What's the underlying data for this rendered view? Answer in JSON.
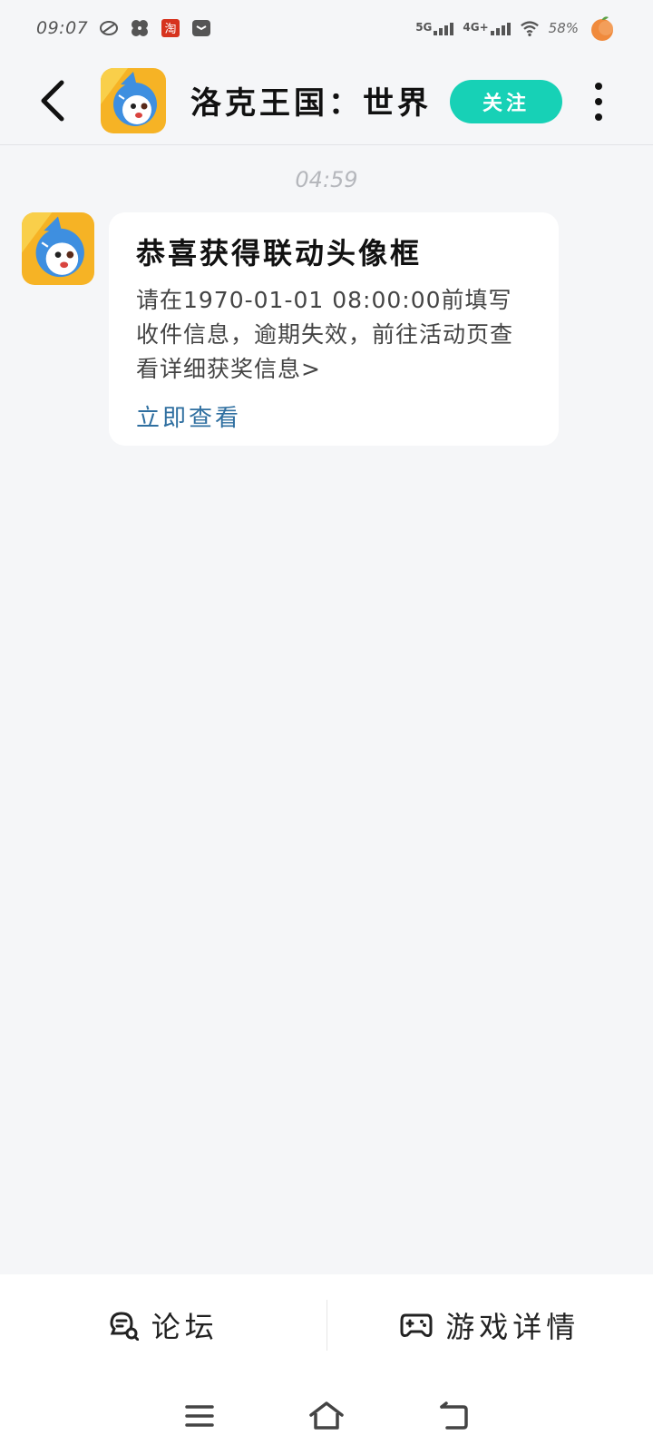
{
  "status_bar": {
    "time": "09:07",
    "network_1": "5G",
    "network_2": "4G+",
    "battery": "58%"
  },
  "header": {
    "title": "洛克王国：世界",
    "follow_label": "关注"
  },
  "chat": {
    "timestamp": "04:59",
    "message": {
      "title": "恭喜获得联动头像框",
      "body": "请在1970-01-01 08:00:00前填写收件信息，逾期失效，前往活动页查看详细获奖信息>",
      "link": "立即查看"
    }
  },
  "bottom_tabs": [
    {
      "label": "论坛",
      "icon": "forum-icon"
    },
    {
      "label": "游戏详情",
      "icon": "gamepad-icon"
    }
  ],
  "colors": {
    "accent": "#17d1b6",
    "link": "#2f6fa0",
    "background": "#f5f6f8"
  }
}
